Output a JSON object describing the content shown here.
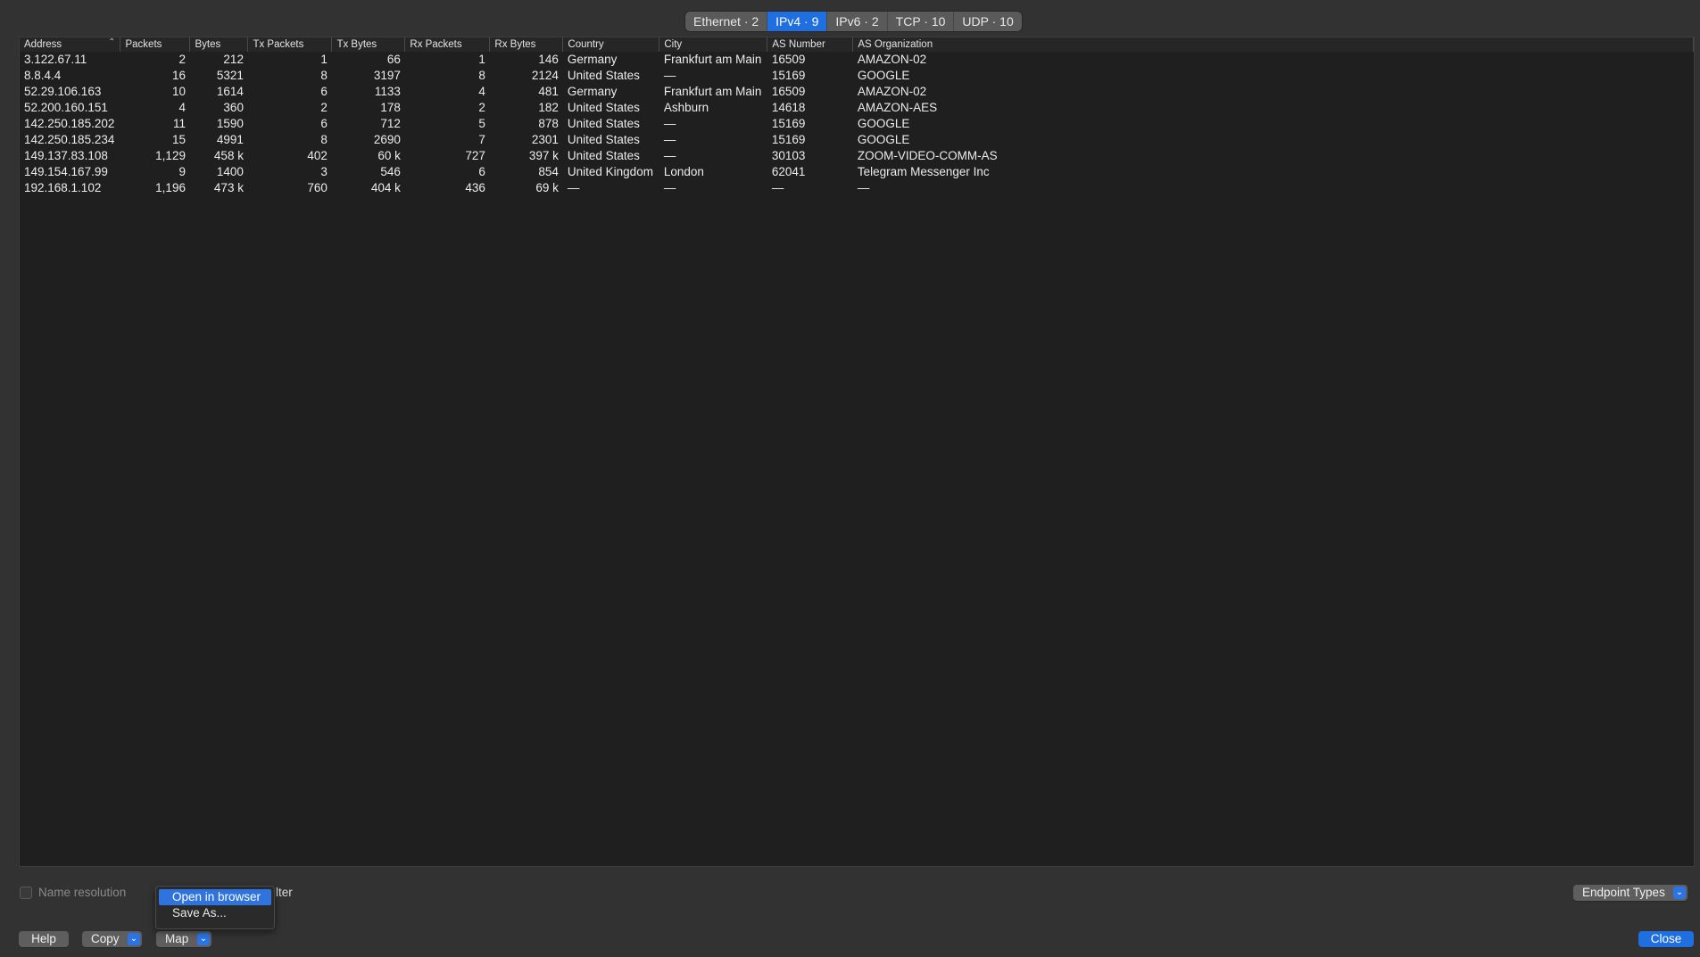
{
  "tabs": [
    {
      "label": "Ethernet · 2",
      "active": false
    },
    {
      "label": "IPv4 · 9",
      "active": true
    },
    {
      "label": "IPv6 · 2",
      "active": false
    },
    {
      "label": "TCP · 10",
      "active": false
    },
    {
      "label": "UDP · 10",
      "active": false
    }
  ],
  "table": {
    "columns": [
      "Address",
      "Packets",
      "Bytes",
      "Tx Packets",
      "Tx Bytes",
      "Rx Packets",
      "Rx Bytes",
      "Country",
      "City",
      "AS Number",
      "AS Organization"
    ],
    "sort_column": "Address",
    "sort_icon": "sort-ascending-icon",
    "rows": [
      [
        "3.122.67.11",
        "2",
        "212",
        "1",
        "66",
        "1",
        "146",
        "Germany",
        "Frankfurt am Main",
        "16509",
        "AMAZON-02"
      ],
      [
        "8.8.4.4",
        "16",
        "5321",
        "8",
        "3197",
        "8",
        "2124",
        "United States",
        "—",
        "15169",
        "GOOGLE"
      ],
      [
        "52.29.106.163",
        "10",
        "1614",
        "6",
        "1133",
        "4",
        "481",
        "Germany",
        "Frankfurt am Main",
        "16509",
        "AMAZON-02"
      ],
      [
        "52.200.160.151",
        "4",
        "360",
        "2",
        "178",
        "2",
        "182",
        "United States",
        "Ashburn",
        "14618",
        "AMAZON-AES"
      ],
      [
        "142.250.185.202",
        "11",
        "1590",
        "6",
        "712",
        "5",
        "878",
        "United States",
        "—",
        "15169",
        "GOOGLE"
      ],
      [
        "142.250.185.234",
        "15",
        "4991",
        "8",
        "2690",
        "7",
        "2301",
        "United States",
        "—",
        "15169",
        "GOOGLE"
      ],
      [
        "149.137.83.108",
        "1,129",
        "458 k",
        "402",
        "60 k",
        "727",
        "397 k",
        "United States",
        "—",
        "30103",
        "ZOOM-VIDEO-COMM-AS"
      ],
      [
        "149.154.167.99",
        "9",
        "1400",
        "3",
        "546",
        "6",
        "854",
        "United Kingdom",
        "London",
        "62041",
        "Telegram Messenger Inc"
      ],
      [
        "192.168.1.102",
        "1,196",
        "473 k",
        "760",
        "404 k",
        "436",
        "69 k",
        "—",
        "—",
        "—",
        "—"
      ]
    ]
  },
  "footer": {
    "name_resolution_label": "Name resolution",
    "filter_suffix": "lter",
    "help_label": "Help",
    "copy_label": "Copy",
    "map_label": "Map",
    "endpoint_types_label": "Endpoint Types",
    "close_label": "Close"
  },
  "map_menu": {
    "items": [
      "Open in browser",
      "Save As..."
    ],
    "highlighted_index": 0
  },
  "colors": {
    "accent": "#1f6fe0",
    "background": "#323232",
    "table_bg": "#1f1f1f"
  }
}
